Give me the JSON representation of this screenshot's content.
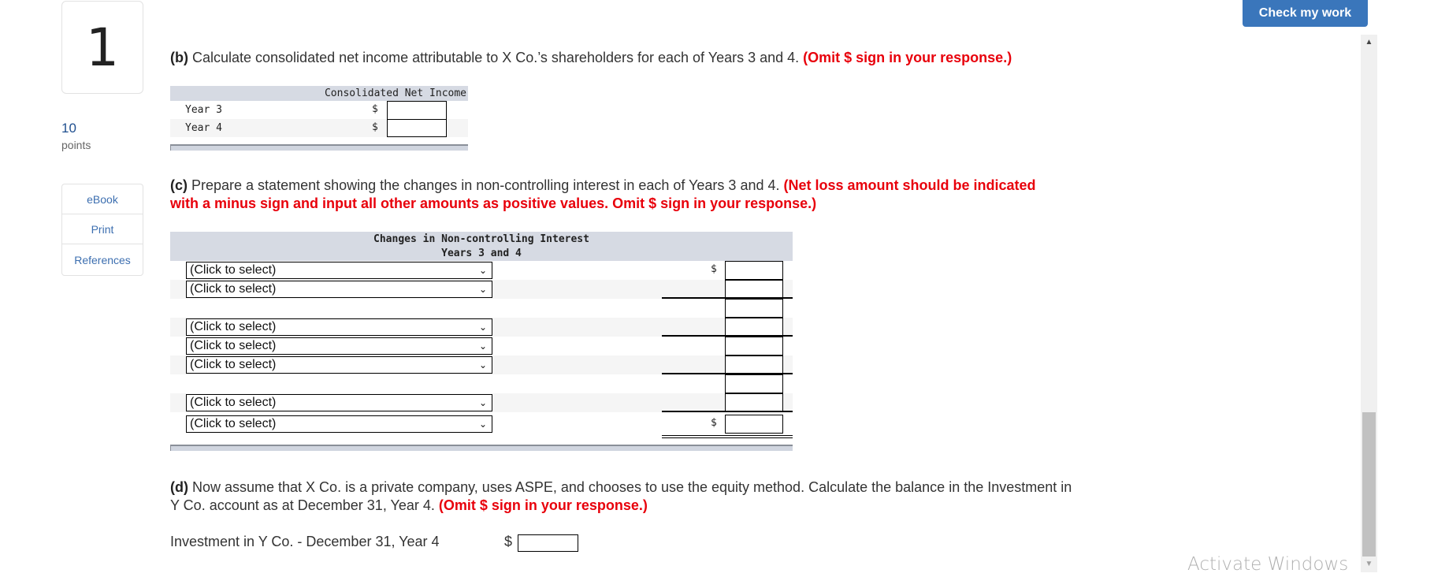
{
  "question": {
    "number": "1",
    "points_value": "10",
    "points_label": "points"
  },
  "side_links": [
    "eBook",
    "Print",
    "References"
  ],
  "check_button": "Check my work",
  "part_b": {
    "label": "(b)",
    "text": " Calculate consolidated net income attributable to X Co.’s shareholders for each of Years 3 and 4. ",
    "instruction": "(Omit $ sign in your response.)",
    "table": {
      "header": "Consolidated Net Income",
      "rows": [
        {
          "label": "Year 3",
          "currency": "$",
          "value": ""
        },
        {
          "label": "Year 4",
          "currency": "$",
          "value": ""
        }
      ]
    }
  },
  "part_c": {
    "label": "(c)",
    "text": " Prepare a statement showing the changes in non-controlling interest in each of Years 3 and 4. ",
    "instruction": "(Net loss amount should be indicated with a minus sign and input all other amounts as positive values. Omit $ sign in your response.)",
    "table": {
      "title": "Changes in Non-controlling Interest",
      "subtitle": "Years 3 and 4",
      "rows": [
        {
          "select": "(Click to select)",
          "currency": "$",
          "value": ""
        },
        {
          "select": "(Click to select)",
          "currency": "",
          "value": ""
        },
        {
          "select": null,
          "currency": "",
          "value": ""
        },
        {
          "select": "(Click to select)",
          "currency": "",
          "value": ""
        },
        {
          "select": "(Click to select)",
          "currency": "",
          "value": ""
        },
        {
          "select": "(Click to select)",
          "currency": "",
          "value": ""
        },
        {
          "select": null,
          "currency": "",
          "value": ""
        },
        {
          "select": "(Click to select)",
          "currency": "",
          "value": ""
        },
        {
          "select": "(Click to select)",
          "currency": "$",
          "value": ""
        }
      ]
    }
  },
  "part_d": {
    "label": "(d)",
    "text": " Now assume that X Co. is a private company, uses ASPE, and chooses to use the equity method. Calculate the balance in the Investment in Y Co. account as at December 31, Year 4. ",
    "instruction": "(Omit $ sign in your response.)",
    "field_label": "Investment in Y Co. - December 31, Year 4",
    "currency": "$",
    "value": ""
  },
  "watermark": "Activate Windows",
  "icons": {
    "chevron": "⌄",
    "scroll_up": "▲",
    "scroll_down": "▼"
  }
}
